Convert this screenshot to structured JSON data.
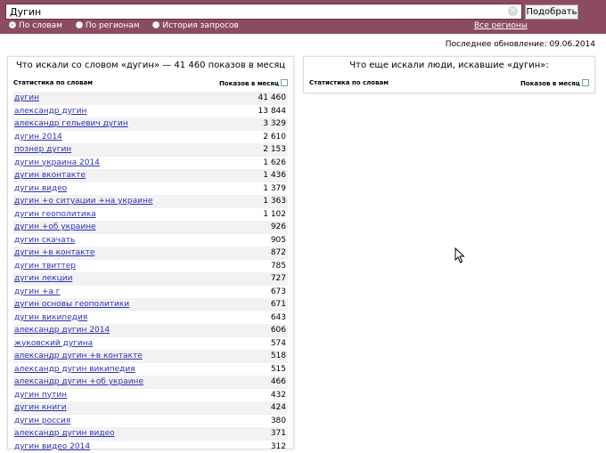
{
  "search": {
    "query": "Дугин",
    "submit_label": "Подобрать"
  },
  "tabs": [
    {
      "label": "По словам",
      "checked": true
    },
    {
      "label": "По регионам",
      "checked": false
    },
    {
      "label": "История запросов",
      "checked": false
    }
  ],
  "all_regions_label": "Все регионы",
  "last_update": "Последнее обновление: 09.06.2014",
  "left": {
    "title": "Что искали со словом «дугин» — 41 460 показов в месяц",
    "col_left": "Статистика по словам",
    "col_right": "Показов в месяц",
    "rows": [
      {
        "phrase": "дугин",
        "count": "41 460"
      },
      {
        "phrase": "александр дугин",
        "count": "13 844"
      },
      {
        "phrase": "александр гельевич дугин",
        "count": "3 329"
      },
      {
        "phrase": "дугин 2014",
        "count": "2 610"
      },
      {
        "phrase": "познер дугин",
        "count": "2 153"
      },
      {
        "phrase": "дугин украина 2014",
        "count": "1 626"
      },
      {
        "phrase": "дугин вконтакте",
        "count": "1 436"
      },
      {
        "phrase": "дугин видео",
        "count": "1 379"
      },
      {
        "phrase": "дугин +о ситуации +на украине",
        "count": "1 363"
      },
      {
        "phrase": "дугин геополитика",
        "count": "1 102"
      },
      {
        "phrase": "дугин +об украине",
        "count": "926"
      },
      {
        "phrase": "дугин скачать",
        "count": "905"
      },
      {
        "phrase": "дугин +в контакте",
        "count": "872"
      },
      {
        "phrase": "дугин твиттер",
        "count": "785"
      },
      {
        "phrase": "дугин лекции",
        "count": "727"
      },
      {
        "phrase": "дугин +а г",
        "count": "673"
      },
      {
        "phrase": "дугин основы геополитики",
        "count": "671"
      },
      {
        "phrase": "дугин википедия",
        "count": "643"
      },
      {
        "phrase": "александр дугин 2014",
        "count": "606"
      },
      {
        "phrase": "жуковский дугина",
        "count": "574"
      },
      {
        "phrase": "александр дугин +в контакте",
        "count": "518"
      },
      {
        "phrase": "александр дугин википедия",
        "count": "515"
      },
      {
        "phrase": "александр дугин +об украине",
        "count": "466"
      },
      {
        "phrase": "дугин путин",
        "count": "432"
      },
      {
        "phrase": "дугин книги",
        "count": "424"
      },
      {
        "phrase": "дугин россия",
        "count": "380"
      },
      {
        "phrase": "александр дугин видео",
        "count": "371"
      },
      {
        "phrase": "дугин видео 2014",
        "count": "312"
      }
    ]
  },
  "right": {
    "title": "Что еще искали люди, искавшие «дугин»:",
    "col_left": "Статистика по словам",
    "col_right": "Показов в месяц"
  },
  "icons": {
    "clear": "clear-icon",
    "cursor": "mouse-cursor-icon"
  }
}
